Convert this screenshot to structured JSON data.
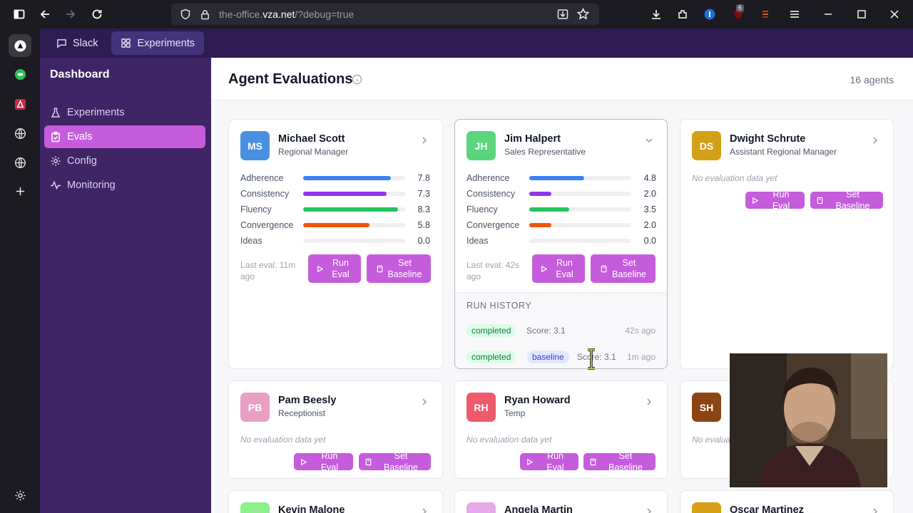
{
  "browser": {
    "url_prefix": "the-office.",
    "url_domain": "vza.net",
    "url_path": "/?debug=true",
    "ext_badge": "6"
  },
  "topbar": {
    "tabs": [
      {
        "label": "Slack",
        "icon": "message-square-icon"
      },
      {
        "label": "Experiments",
        "icon": "grid-icon"
      }
    ]
  },
  "sidebar": {
    "title": "Dashboard",
    "items": [
      {
        "label": "Experiments",
        "icon": "flask-icon"
      },
      {
        "label": "Evals",
        "icon": "clipboard-icon",
        "active": true
      },
      {
        "label": "Config",
        "icon": "gear-icon"
      },
      {
        "label": "Monitoring",
        "icon": "activity-icon"
      }
    ]
  },
  "main": {
    "title": "Agent Evaluations",
    "agent_count": "16 agents",
    "run_eval": "Run Eval",
    "set_baseline": "Set Baseline",
    "no_data": "No evaluation data yet",
    "cards": [
      {
        "initials": "MS",
        "name": "Michael Scott",
        "role": "Regional Manager",
        "color": "#4a90e2",
        "metrics": [
          {
            "label": "Adherence",
            "value": "7.8",
            "fraction": 0.86,
            "color": "#3b82f6"
          },
          {
            "label": "Consistency",
            "value": "7.3",
            "fraction": 0.82,
            "color": "#9333ea"
          },
          {
            "label": "Fluency",
            "value": "8.3",
            "fraction": 0.93,
            "color": "#22c55e"
          },
          {
            "label": "Convergence",
            "value": "5.8",
            "fraction": 0.65,
            "color": "#ea580c"
          },
          {
            "label": "Ideas",
            "value": "0.0",
            "fraction": 0.0,
            "color": "#9ca3af"
          }
        ],
        "last_eval": "Last eval: 11m ago"
      },
      {
        "initials": "JH",
        "name": "Jim Halpert",
        "role": "Sales Representative",
        "color": "#5ad57b",
        "metrics": [
          {
            "label": "Adherence",
            "value": "4.8",
            "fraction": 0.54,
            "color": "#3b82f6"
          },
          {
            "label": "Consistency",
            "value": "2.0",
            "fraction": 0.22,
            "color": "#9333ea"
          },
          {
            "label": "Fluency",
            "value": "3.5",
            "fraction": 0.39,
            "color": "#22c55e"
          },
          {
            "label": "Convergence",
            "value": "2.0",
            "fraction": 0.22,
            "color": "#ea580c"
          },
          {
            "label": "Ideas",
            "value": "0.0",
            "fraction": 0.0,
            "color": "#9ca3af"
          }
        ],
        "last_eval": "Last eval: 42s ago",
        "history": {
          "title": "RUN HISTORY",
          "runs": [
            {
              "status": "completed",
              "score": "Score: 3.1",
              "time": "42s ago"
            },
            {
              "status": "completed",
              "badge": "baseline",
              "score": "Score: 3.1",
              "time": "1m ago"
            }
          ]
        }
      },
      {
        "initials": "DS",
        "name": "Dwight Schrute",
        "role": "Assistant Regional Manager",
        "color": "#d4a017"
      },
      {
        "initials": "PB",
        "name": "Pam Beesly",
        "role": "Receptionist",
        "color": "#e9a0c4"
      },
      {
        "initials": "RH",
        "name": "Ryan Howard",
        "role": "Temp",
        "color": "#ee5a6b"
      },
      {
        "initials": "SH",
        "color": "#8b4513"
      },
      {
        "initials": "",
        "name": "Kevin Malone",
        "color": "#8ef08a"
      },
      {
        "initials": "",
        "name": "Angela Martin",
        "color": "#e6a8e8"
      },
      {
        "initials": "",
        "name": "Oscar Martinez",
        "color": "#d4a017"
      }
    ]
  }
}
